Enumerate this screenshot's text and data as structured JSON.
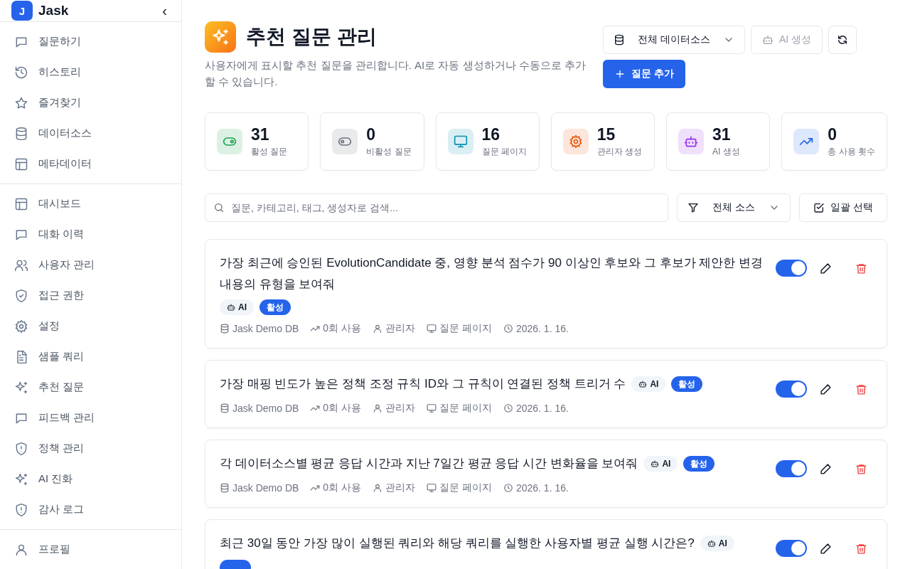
{
  "sidebar": {
    "logo_letter": "J",
    "app_name": "Jask",
    "collapse_glyph": "‹",
    "groups": [
      [
        {
          "label": "질문하기"
        },
        {
          "label": "히스토리"
        },
        {
          "label": "즐겨찾기"
        },
        {
          "label": "데이터소스"
        },
        {
          "label": "메타데이터"
        }
      ],
      [
        {
          "label": "대시보드"
        },
        {
          "label": "대화 이력"
        },
        {
          "label": "사용자 관리"
        },
        {
          "label": "접근 권한"
        },
        {
          "label": "설정"
        },
        {
          "label": "샘플 쿼리"
        },
        {
          "label": "추천 질문"
        },
        {
          "label": "피드백 관리"
        },
        {
          "label": "정책 관리"
        },
        {
          "label": "AI 진화"
        },
        {
          "label": "감사 로그"
        }
      ],
      [
        {
          "label": "프로필"
        }
      ]
    ]
  },
  "header": {
    "title": "추천 질문 관리",
    "description": "사용자에게 표시할 추천 질문을 관리합니다. AI로 자동 생성하거나 수동으로 추가할 수 있습니다.",
    "source_select": "전체 데이터소스",
    "ai_button": {
      "label": "AI 생성",
      "disabled": true
    },
    "add_button": "질문 추가"
  },
  "stats": [
    {
      "value": "31",
      "label": "활성 질문",
      "color": "#16a34a"
    },
    {
      "value": "0",
      "label": "비활성 질문",
      "color": "#6b7280"
    },
    {
      "value": "16",
      "label": "질문 페이지",
      "color": "#0891b2"
    },
    {
      "value": "15",
      "label": "관리자 생성",
      "color": "#ea580c"
    },
    {
      "value": "31",
      "label": "AI 생성",
      "color": "#9333ea"
    },
    {
      "value": "0",
      "label": "총 사용 횟수",
      "color": "#2563eb"
    }
  ],
  "filters": {
    "search_placeholder": "질문, 카테고리, 태그, 생성자로 검색...",
    "source_filter": "전체 소스",
    "bulk_select": "일괄 선택"
  },
  "questions": [
    {
      "text": "가장 최근에 승인된 EvolutionCandidate 중, 영향 분석 점수가 90 이상인 후보와 그 후보가 제안한 변경 내용의 유형을 보여줘",
      "badges": [
        {
          "kind": "ai",
          "label": "AI"
        },
        {
          "kind": "status",
          "label": "활성"
        }
      ],
      "meta": {
        "source": "Jask Demo DB",
        "usage": "0회 사용",
        "author": "관리자",
        "page": "질문 페이지",
        "date": "2026. 1. 16."
      },
      "on": true
    },
    {
      "text": "가장 매핑 빈도가 높은 정책 조정 규칙 ID와 그 규칙이 연결된 정책 트리거 수",
      "badges": [
        {
          "kind": "ai",
          "label": "AI"
        },
        {
          "kind": "status",
          "label": "활성"
        }
      ],
      "meta": {
        "source": "Jask Demo DB",
        "usage": "0회 사용",
        "author": "관리자",
        "page": "질문 페이지",
        "date": "2026. 1. 16."
      },
      "on": true
    },
    {
      "text": "각 데이터소스별 평균 응답 시간과 지난 7일간 평균 응답 시간 변화율을 보여줘",
      "badges": [
        {
          "kind": "ai",
          "label": "AI"
        },
        {
          "kind": "status",
          "label": "활성"
        }
      ],
      "meta": {
        "source": "Jask Demo DB",
        "usage": "0회 사용",
        "author": "관리자",
        "page": "질문 페이지",
        "date": "2026. 1. 16."
      },
      "on": true
    },
    {
      "text": "최근 30일 동안 가장 많이 실행된 쿼리와 해당 쿼리를 실행한 사용자별 평균 실행 시간은?",
      "badges": [
        {
          "kind": "ai",
          "label": "AI"
        },
        {
          "kind": "status"
        }
      ],
      "on": true
    }
  ]
}
